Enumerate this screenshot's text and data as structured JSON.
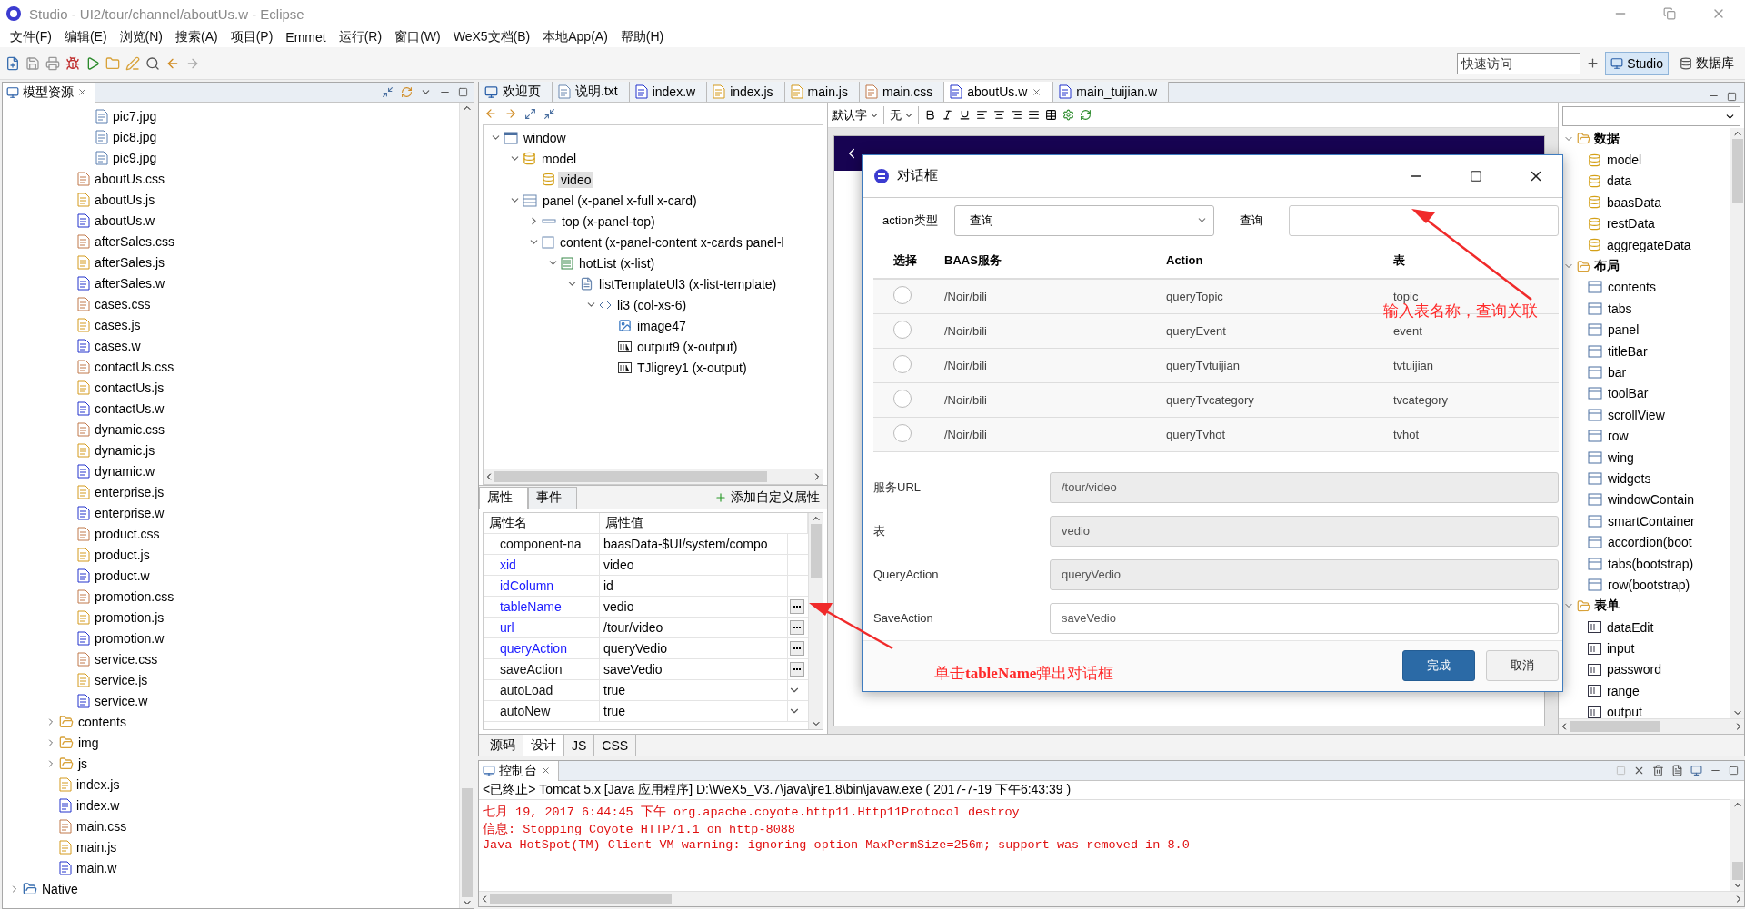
{
  "window": {
    "title": "Studio - UI2/tour/channel/aboutUs.w - Eclipse"
  },
  "menu": [
    "文件(F)",
    "编辑(E)",
    "浏览(N)",
    "搜索(A)",
    "项目(P)",
    "Emmet",
    "运行(R)",
    "窗口(W)",
    "WeX5文档(B)",
    "本地App(A)",
    "帮助(H)"
  ],
  "quick_access": {
    "placeholder": "快速访问"
  },
  "perspectives": [
    {
      "label": "Studio",
      "selected": true
    },
    {
      "label": "数据库",
      "selected": false
    }
  ],
  "model_resources": {
    "title": "模型资源",
    "tree": [
      {
        "children": [
          {
            "children": [
              {
                "children": [
                  {
                    "label": "pic7.jpg",
                    "kind": "image"
                  },
                  {
                    "label": "pic8.jpg",
                    "kind": "image"
                  },
                  {
                    "label": "pic9.jpg",
                    "kind": "image"
                  }
                ]
              },
              {
                "label": "aboutUs.css",
                "kind": "css"
              },
              {
                "label": "aboutUs.js",
                "kind": "js"
              },
              {
                "label": "aboutUs.w",
                "kind": "w"
              },
              {
                "label": "afterSales.css",
                "kind": "css"
              },
              {
                "label": "afterSales.js",
                "kind": "js"
              },
              {
                "label": "afterSales.w",
                "kind": "w"
              },
              {
                "label": "cases.css",
                "kind": "css"
              },
              {
                "label": "cases.js",
                "kind": "js"
              },
              {
                "label": "cases.w",
                "kind": "w"
              },
              {
                "label": "contactUs.css",
                "kind": "css"
              },
              {
                "label": "contactUs.js",
                "kind": "js"
              },
              {
                "label": "contactUs.w",
                "kind": "w"
              },
              {
                "label": "dynamic.css",
                "kind": "css"
              },
              {
                "label": "dynamic.js",
                "kind": "js"
              },
              {
                "label": "dynamic.w",
                "kind": "w"
              },
              {
                "label": "enterprise.js",
                "kind": "js"
              },
              {
                "label": "enterprise.w",
                "kind": "w"
              },
              {
                "label": "product.css",
                "kind": "css"
              },
              {
                "label": "product.js",
                "kind": "js"
              },
              {
                "label": "product.w",
                "kind": "w"
              },
              {
                "label": "promotion.css",
                "kind": "css"
              },
              {
                "label": "promotion.js",
                "kind": "js"
              },
              {
                "label": "promotion.w",
                "kind": "w"
              },
              {
                "label": "service.css",
                "kind": "css"
              },
              {
                "label": "service.js",
                "kind": "js"
              },
              {
                "label": "service.w",
                "kind": "w"
              }
            ]
          },
          {
            "label": "contents",
            "kind": "folder",
            "expanded": false
          },
          {
            "label": "img",
            "kind": "folder",
            "expanded": false
          },
          {
            "label": "js",
            "kind": "folder",
            "expanded": false
          },
          {
            "label": "index.js",
            "kind": "js"
          },
          {
            "label": "index.w",
            "kind": "w"
          },
          {
            "label": "main.css",
            "kind": "css"
          },
          {
            "label": "main.js",
            "kind": "js"
          },
          {
            "label": "main.w",
            "kind": "w"
          }
        ]
      },
      {
        "label": "Native",
        "kind": "project",
        "expanded": false
      }
    ]
  },
  "editor_tabs": [
    {
      "label": "欢迎页",
      "kind": "welcome",
      "selected": false
    },
    {
      "label": "说明.txt",
      "kind": "txt",
      "selected": false
    },
    {
      "label": "index.w",
      "kind": "w",
      "selected": false
    },
    {
      "label": "index.js",
      "kind": "js",
      "selected": false
    },
    {
      "label": "main.js",
      "kind": "js",
      "selected": false
    },
    {
      "label": "main.css",
      "kind": "css",
      "selected": false
    },
    {
      "label": "aboutUs.w",
      "kind": "w",
      "selected": true
    },
    {
      "label": "main_tuijian.w",
      "kind": "w",
      "selected": false
    }
  ],
  "outline": [
    {
      "label": "window",
      "kind": "window",
      "expanded": true,
      "selected": false,
      "children": [
        {
          "label": "model",
          "kind": "model",
          "expanded": true,
          "selected": false,
          "children": [
            {
              "label": "video",
              "kind": "model",
              "selected": true
            }
          ]
        },
        {
          "label": "panel (x-panel x-full x-card)",
          "kind": "panel",
          "expanded": true,
          "selected": false,
          "children": [
            {
              "label": "top (x-panel-top)",
              "kind": "top",
              "expanded": false,
              "selected": false
            },
            {
              "label": "content (x-panel-content x-cards panel-l",
              "kind": "content",
              "expanded": true,
              "selected": false,
              "children": [
                {
                  "label": "hotList (x-list)",
                  "kind": "list",
                  "expanded": true,
                  "selected": false,
                  "children": [
                    {
                      "label": "listTemplateUl3 (x-list-template)",
                      "kind": "template",
                      "expanded": true,
                      "selected": false,
                      "children": [
                        {
                          "label": "li3 (col-xs-6)",
                          "kind": "li",
                          "expanded": true,
                          "selected": false,
                          "children": [
                            {
                              "label": "image47",
                              "kind": "image",
                              "selected": false
                            },
                            {
                              "label": "output9 (x-output)",
                              "kind": "output",
                              "selected": false
                            },
                            {
                              "label": "TJligrey1 (x-output)",
                              "kind": "output",
                              "selected": false
                            }
                          ]
                        }
                      ]
                    }
                  ]
                }
              ]
            }
          ]
        }
      ]
    }
  ],
  "properties": {
    "tabs": [
      {
        "label": "属性",
        "selected": true
      },
      {
        "label": "事件",
        "selected": false
      }
    ],
    "add_button": "添加自定义属性",
    "columns": [
      "属性名",
      "属性值"
    ],
    "rows": [
      {
        "name": "component-na",
        "value": "baasData-$UI/system/compo",
        "modified": false,
        "kind": "text"
      },
      {
        "name": "xid",
        "value": "video",
        "modified": true,
        "kind": "text"
      },
      {
        "name": "idColumn",
        "value": "id",
        "modified": true,
        "kind": "text"
      },
      {
        "name": "tableName",
        "value": "vedio",
        "modified": true,
        "kind": "dialog"
      },
      {
        "name": "url",
        "value": "/tour/video",
        "modified": true,
        "kind": "dialog"
      },
      {
        "name": "queryAction",
        "value": "queryVedio",
        "modified": true,
        "kind": "dialog"
      },
      {
        "name": "saveAction",
        "value": "saveVedio",
        "modified": false,
        "kind": "dialog"
      },
      {
        "name": "autoLoad",
        "value": "true",
        "modified": false,
        "kind": "select"
      },
      {
        "name": "autoNew",
        "value": "true",
        "modified": false,
        "kind": "select"
      }
    ]
  },
  "design_toolbar": {
    "font": "默认字",
    "size": "无"
  },
  "bottom_tabs": [
    {
      "label": "源码",
      "selected": false
    },
    {
      "label": "设计",
      "selected": true
    },
    {
      "label": "JS",
      "selected": false
    },
    {
      "label": "CSS",
      "selected": false
    }
  ],
  "palette": {
    "groups": [
      {
        "label": "数据",
        "kind": "data",
        "expanded": true,
        "items": [
          "model",
          "data",
          "baasData",
          "restData",
          "aggregateData"
        ]
      },
      {
        "label": "布局",
        "kind": "layout",
        "expanded": true,
        "items": [
          "contents",
          "tabs",
          "panel",
          "titleBar",
          "bar",
          "toolBar",
          "scrollView",
          "row",
          "wing",
          "widgets",
          "windowContain",
          "smartContainer",
          "accordion(boot",
          "tabs(bootstrap)",
          "row(bootstrap)"
        ]
      },
      {
        "label": "表单",
        "kind": "form",
        "expanded": true,
        "items": [
          "dataEdit",
          "input",
          "password",
          "range",
          "output"
        ]
      }
    ]
  },
  "dialog": {
    "title": "对话框",
    "action_type_label": "action类型",
    "action_type": "查询",
    "query_label": "查询",
    "columns": [
      "选择",
      "BAAS服务",
      "Action",
      "表"
    ],
    "rows": [
      {
        "service": "/Noir/bili",
        "action": "queryTopic",
        "table": "topic",
        "selected": false
      },
      {
        "service": "/Noir/bili",
        "action": "queryEvent",
        "table": "event",
        "selected": false
      },
      {
        "service": "/Noir/bili",
        "action": "queryTvtuijian",
        "table": "tvtuijian",
        "selected": false
      },
      {
        "service": "/Noir/bili",
        "action": "queryTvcategory",
        "table": "tvcategory",
        "selected": false
      },
      {
        "service": "/Noir/bili",
        "action": "queryTvhot",
        "table": "tvhot",
        "selected": false
      }
    ],
    "fields": [
      {
        "label": "服务URL",
        "value": "/tour/video",
        "disabled": true
      },
      {
        "label": "表",
        "value": "vedio",
        "disabled": true
      },
      {
        "label": "QueryAction",
        "value": "queryVedio",
        "disabled": true
      },
      {
        "label": "SaveAction",
        "value": "saveVedio",
        "disabled": false
      }
    ],
    "buttons": [
      {
        "label": "完成",
        "kind": "primary"
      },
      {
        "label": "取消",
        "kind": "default"
      }
    ]
  },
  "annotations": [
    {
      "text": "输入表名称，查询关联"
    },
    {
      "text": "单击**tableName**弹出对话框"
    }
  ],
  "console": {
    "title": "控制台",
    "header": "<已终止> Tomcat 5.x [Java 应用程序] D:\\WeX5_V3.7\\java\\jre1.8\\bin\\javaw.exe ( 2017-7-19 下午6:43:39 )",
    "lines": [
      "七月 19, 2017 6:44:45 下午 org.apache.coyote.http11.Http11Protocol destroy",
      "信息: Stopping Coyote HTTP/1.1 on http-8088",
      "Java HotSpot(TM) Client VM warning: ignoring option MaxPermSize=256m; support was removed in 8.0"
    ]
  }
}
